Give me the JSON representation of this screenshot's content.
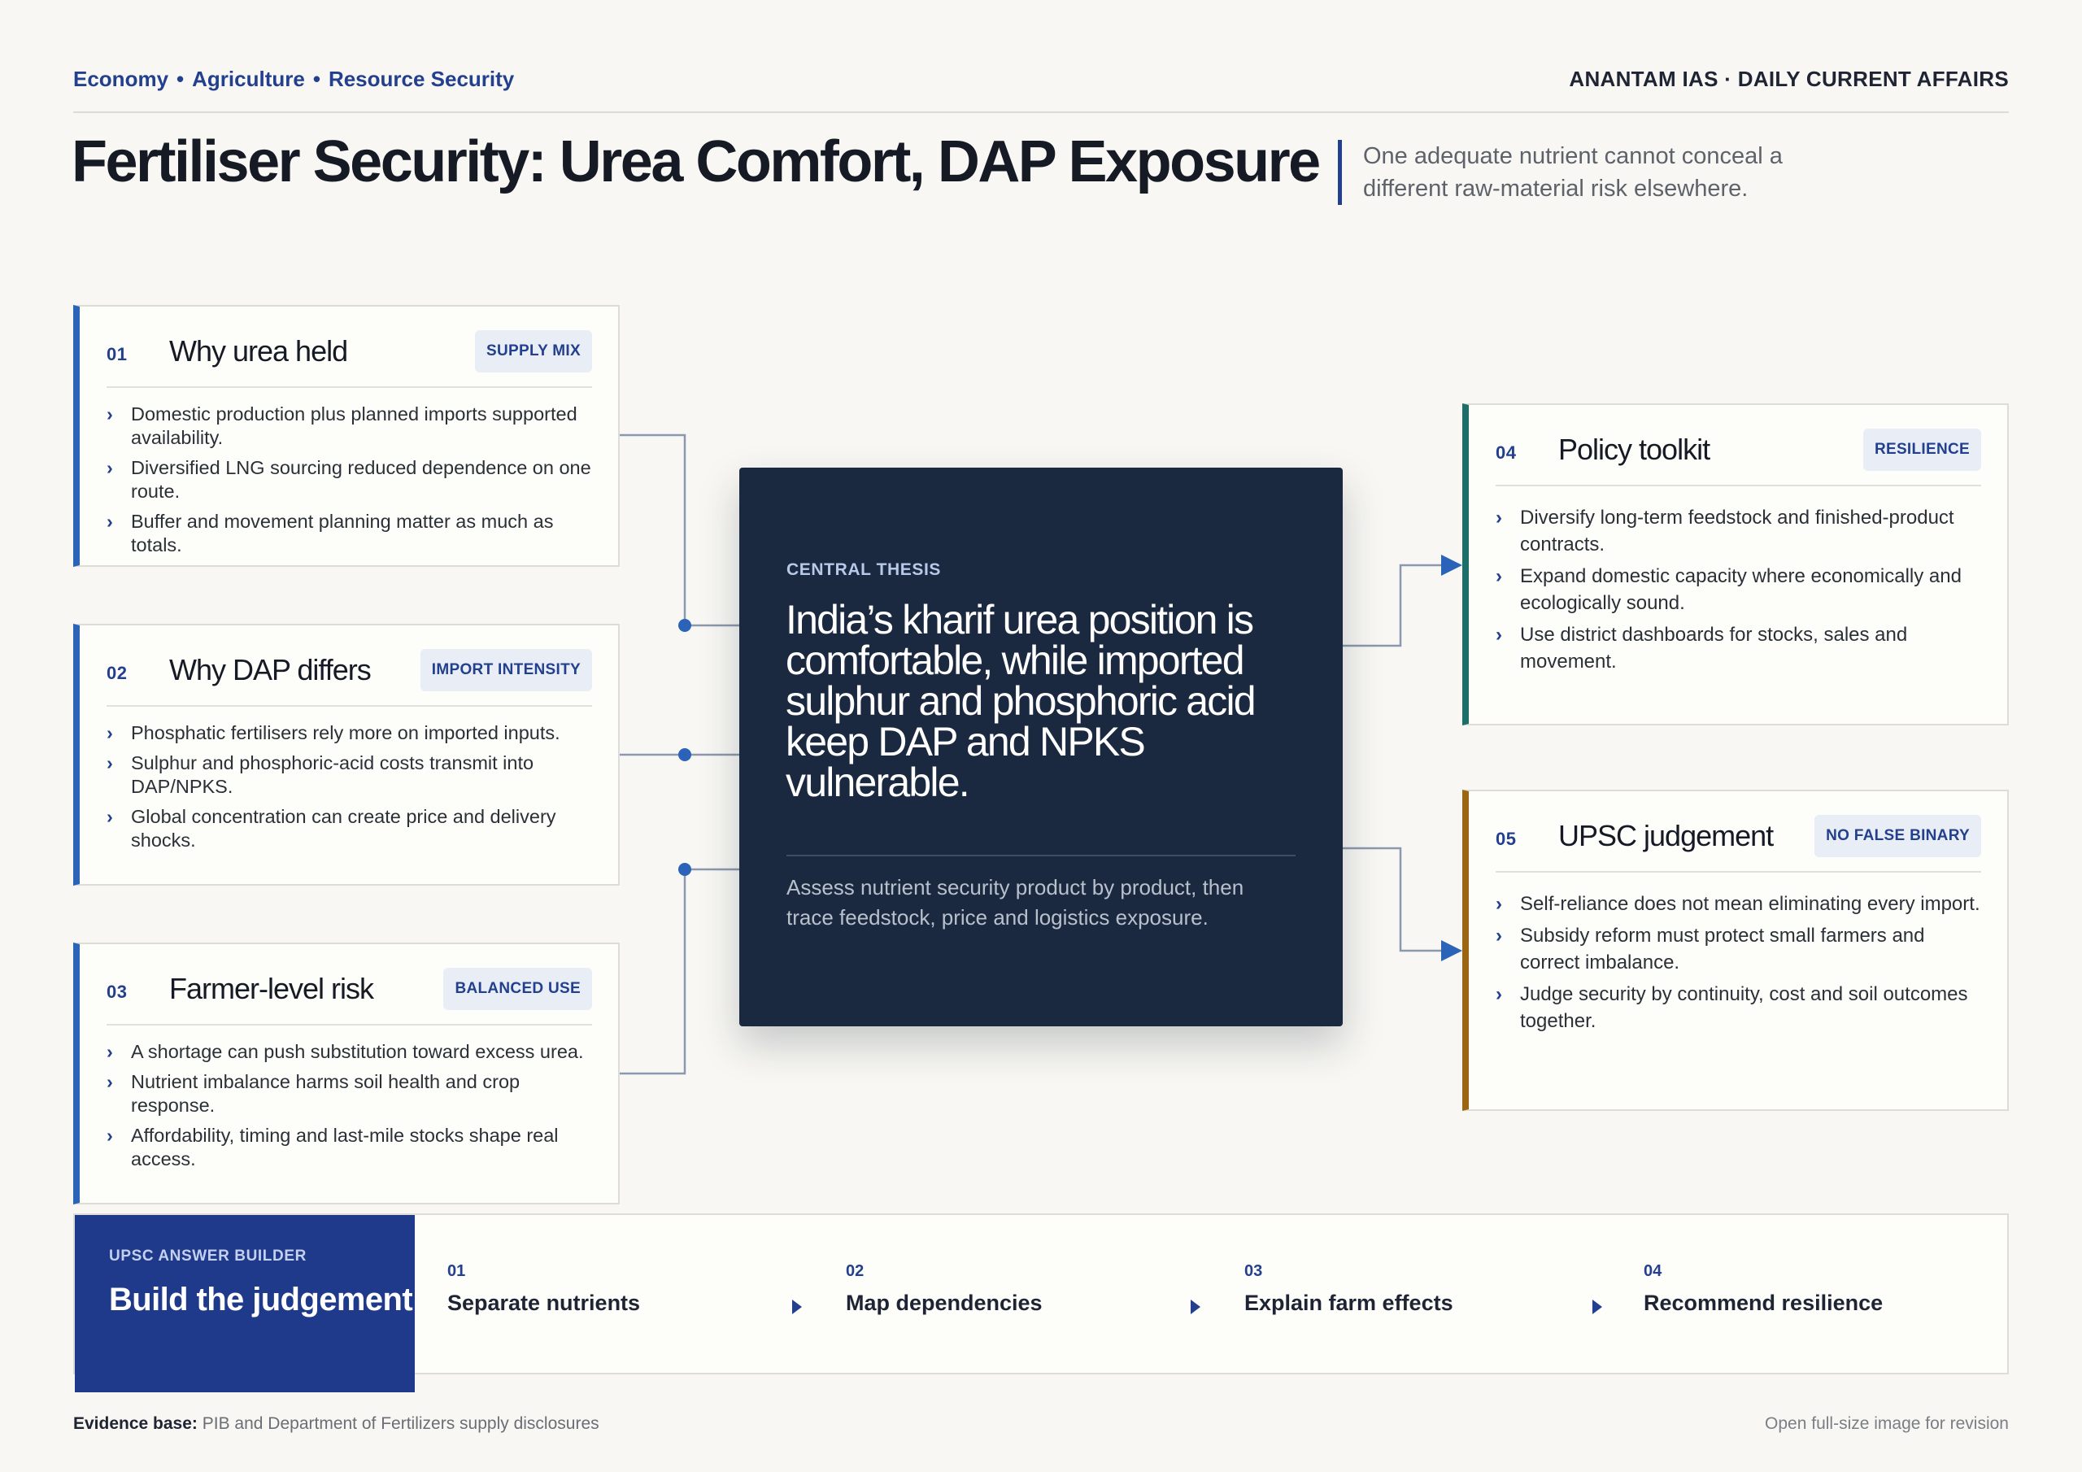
{
  "header": {
    "breadcrumbs": [
      "Economy",
      "Agriculture",
      "Resource Security"
    ],
    "separator": "•",
    "brand": "ANANTAM IAS · DAILY CURRENT AFFAIRS",
    "title": "Fertiliser Security: Urea Comfort, DAP Exposure",
    "subtitle": "One adequate nutrient cannot conceal a different raw-material risk elsewhere."
  },
  "cards": [
    {
      "num": "01",
      "title": "Why urea held",
      "badge": "SUPPLY MIX",
      "points": [
        "Domestic production plus planned imports supported availability.",
        "Diversified LNG sourcing reduced dependence on one route.",
        "Buffer and movement planning matter as much as totals."
      ]
    },
    {
      "num": "02",
      "title": "Why DAP differs",
      "badge": "IMPORT INTENSITY",
      "points": [
        "Phosphatic fertilisers rely more on imported inputs.",
        "Sulphur and phosphoric-acid costs transmit into DAP/NPKS.",
        "Global concentration can create price and delivery shocks."
      ]
    },
    {
      "num": "03",
      "title": "Farmer-level risk",
      "badge": "BALANCED USE",
      "points": [
        "A shortage can push substitution toward excess urea.",
        "Nutrient imbalance harms soil health and crop response.",
        "Affordability, timing and last-mile stocks shape real access."
      ]
    },
    {
      "num": "04",
      "title": "Policy toolkit",
      "badge": "RESILIENCE",
      "points": [
        "Diversify long-term feedstock and finished-product contracts.",
        "Expand domestic capacity where economically and ecologically sound.",
        "Use district dashboards for stocks, sales and movement."
      ]
    },
    {
      "num": "05",
      "title": "UPSC judgement",
      "badge": "NO FALSE BINARY",
      "points": [
        "Self-reliance does not mean eliminating every import.",
        "Subsidy reform must protect small farmers and correct imbalance.",
        "Judge security by continuity, cost and soil outcomes together."
      ]
    }
  ],
  "center": {
    "kicker": "CENTRAL THESIS",
    "thesis": "India’s kharif urea position is comfortable, while imported sulphur and phosphoric acid keep DAP and NPKS vulnerable.",
    "note": "Assess nutrient security product by product, then trace feedstock, price and logistics exposure."
  },
  "builder": {
    "kicker": "UPSC ANSWER BUILDER",
    "title": "Build the judgement",
    "steps": [
      {
        "num": "01",
        "label": "Separate nutrients"
      },
      {
        "num": "02",
        "label": "Map dependencies"
      },
      {
        "num": "03",
        "label": "Explain farm effects"
      },
      {
        "num": "04",
        "label": "Recommend resilience"
      }
    ]
  },
  "footer": {
    "evidence_label": "Evidence base:",
    "evidence_text": "PIB and Department of Fertilizers supply disclosures",
    "open_link": "Open full-size image for revision"
  },
  "colors": {
    "accent_blue": "#2a63b8",
    "navy": "#1b2940",
    "brand_blue": "#23408e",
    "teal": "#1d6e68",
    "amber": "#9a6612"
  }
}
